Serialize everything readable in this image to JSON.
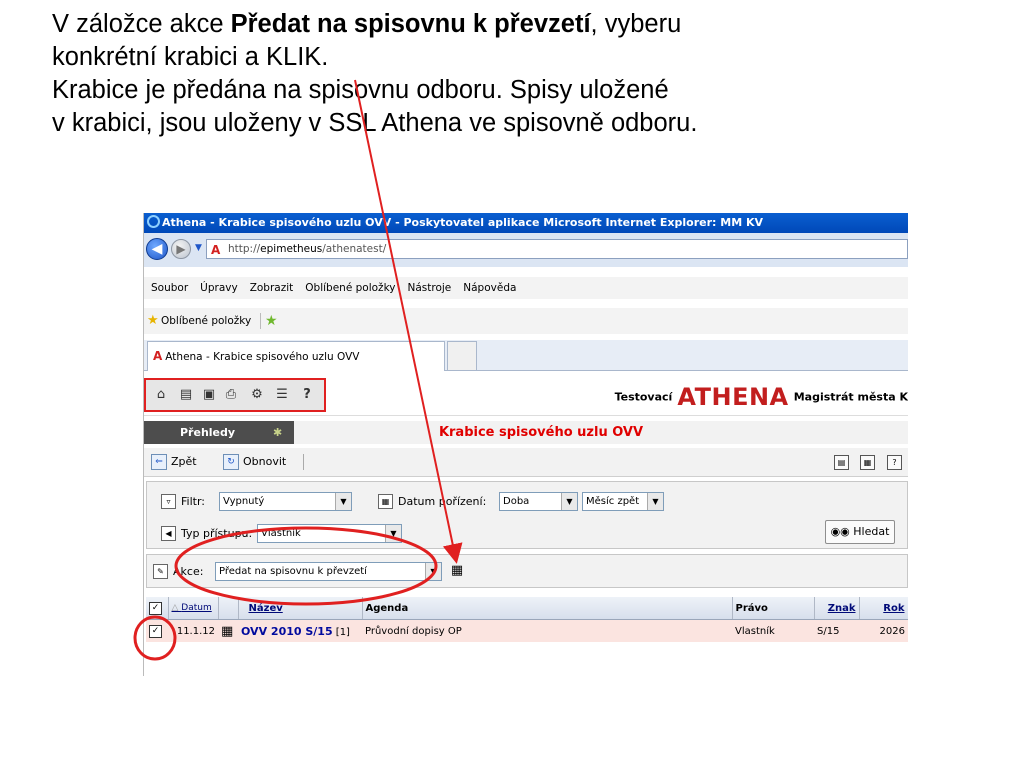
{
  "slide": {
    "line1_pre": "V záložce akce ",
    "line1_bold": "Předat na spisovnu k převzetí",
    "line1_post": ", vyberu",
    "line2": "konkrétní krabici a KLIK.",
    "line3": "Krabice je předána na spisovnu odboru.  Spisy uložené",
    "line4": "v krabici, jsou uloženy v SSL Athena ve spisovně odboru."
  },
  "browser": {
    "title": "Athena - Krabice spisového uzlu OVV - Poskytovatel aplikace Microsoft Internet Explorer: MM KV",
    "url_prefix": "http://",
    "url_host": "epimetheus",
    "url_path": "/athenatest/",
    "menu": [
      "Soubor",
      "Úpravy",
      "Zobrazit",
      "Oblíbené položky",
      "Nástroje",
      "Nápověda"
    ],
    "favorites_label": "Oblíbené položky",
    "tab_label": "Athena - Krabice spisového uzlu OVV"
  },
  "app": {
    "toolbar_help": "?",
    "brand_prefix": "Testovací",
    "brand_name": "ATHENA",
    "brand_suffix": "Magistrát města K",
    "section_label": "Přehledy",
    "page_title": "Krabice spisového uzlu OVV",
    "back_label": "Zpět",
    "refresh_label": "Obnovit",
    "filter_label": "Filtr:",
    "filter_value": "Vypnutý",
    "date_label": "Datum pořízení:",
    "date_value": "Doba",
    "date_period": "Měsíc zpět",
    "access_label": "Typ přístupu:",
    "access_value": "Vlastník",
    "search_label": "Hledat",
    "akce_label": "Akce:",
    "akce_value": "Předat na spisovnu k převzetí"
  },
  "table": {
    "headers": [
      "Datum",
      "Název",
      "Agenda",
      "Právo",
      "Znak",
      "Rok"
    ],
    "rows": [
      {
        "checked": true,
        "datum": "11.1.12",
        "nazev": "OVV 2010 S/15",
        "count": "[1]",
        "agenda": "Průvodní dopisy OP",
        "pravo": "Vlastník",
        "znak": "S/15",
        "rok": "2026"
      }
    ]
  },
  "colors": {
    "annotation_red": "#e02020",
    "title_red": "#e00000",
    "row_highlight": "#fbe4e0",
    "link_blue": "#000a9e"
  },
  "icons": [
    "ie-logo",
    "back-arrow-icon",
    "forward-arrow-icon",
    "athena-logo-icon",
    "favorites-star-icon",
    "home-icon",
    "print-icon",
    "search-binoculars-icon",
    "filter-icon",
    "calendar-icon",
    "box-icon",
    "pin-icon",
    "help-icon"
  ]
}
